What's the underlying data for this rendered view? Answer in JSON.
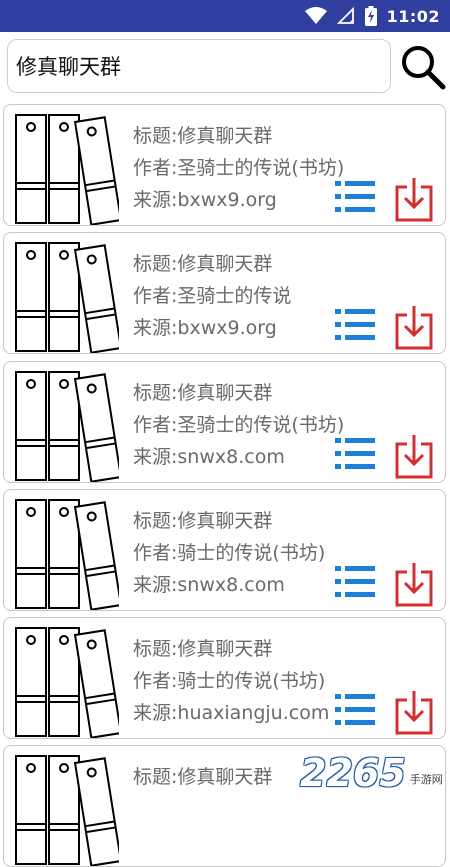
{
  "status_bar": {
    "time": "11:02",
    "background": "#303f9f",
    "icons": [
      "wifi-icon",
      "signal-icon",
      "battery-icon"
    ]
  },
  "search": {
    "value": "修真聊天群",
    "icon": "search-icon"
  },
  "results": [
    {
      "title": "标题:修真聊天群",
      "author": "作者:圣骑士的传说(书坊)",
      "source": "来源:bxwx9.org"
    },
    {
      "title": "标题:修真聊天群",
      "author": "作者:圣骑士的传说",
      "source": "来源:bxwx9.org"
    },
    {
      "title": "标题:修真聊天群",
      "author": "作者:圣骑士的传说(书坊)",
      "source": "来源:snwx8.com"
    },
    {
      "title": "标题:修真聊天群",
      "author": "作者:骑士的传说(书坊)",
      "source": "来源:snwx8.com"
    },
    {
      "title": "标题:修真聊天群",
      "author": "作者:骑士的传说(书坊)",
      "source": "来源:huaxiangju.com"
    },
    {
      "title": "标题:修真聊天群",
      "author": "",
      "source": ""
    }
  ],
  "item_icons": {
    "cover": "book-binders-icon",
    "toc": "list-icon",
    "download": "download-icon"
  },
  "colors": {
    "toc_blue": "#1e7fd8",
    "download_red": "#d32f2f",
    "text_gray": "#6a6a6a"
  },
  "watermark": {
    "number": "2265",
    "text": "手游网"
  }
}
